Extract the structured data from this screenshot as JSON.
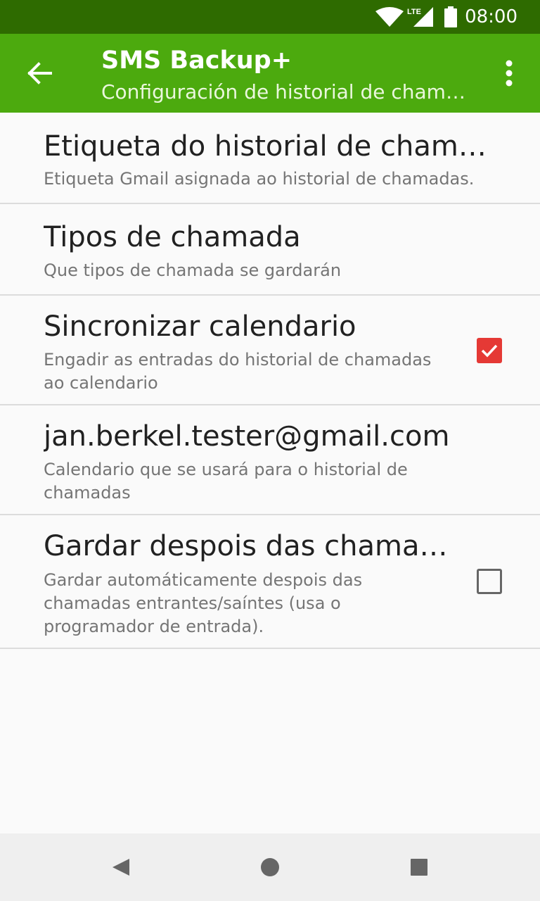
{
  "status_bar": {
    "time": "08:00",
    "icons": [
      "wifi-icon",
      "lte-signal-icon",
      "battery-icon"
    ],
    "network": "LTE"
  },
  "app_bar": {
    "title": "SMS Backup+",
    "subtitle": "Configuración de historial de chamadas",
    "back_icon": "arrow-back-icon",
    "menu_icon": "more-vert-icon"
  },
  "preferences": [
    {
      "title": "Etiqueta do historial de chamadas",
      "summary": "Etiqueta Gmail asignada ao historial de chamadas."
    },
    {
      "title": "Tipos de chamada",
      "summary": "Que tipos de chamada se gardarán"
    },
    {
      "title": "Sincronizar calendario",
      "summary": "Engadir as entradas do historial de chamadas ao calendario",
      "checked": true
    },
    {
      "title": "jan.berkel.tester@gmail.com",
      "summary": "Calendario que se usará para o historial de chamadas"
    },
    {
      "title": "Gardar despois das chamadas",
      "summary": "Gardar automáticamente despois das chamadas entrantes/saíntes (usa o programador de entrada).",
      "checked": false
    }
  ],
  "nav_bar": {
    "icons": [
      "back-triangle-icon",
      "home-circle-icon",
      "recents-square-icon"
    ]
  },
  "colors": {
    "status_bar": "#2e6b00",
    "app_bar": "#4caa0e",
    "checkbox_checked": "#e53935",
    "background": "#fafafa",
    "nav_bar": "#efefef"
  }
}
